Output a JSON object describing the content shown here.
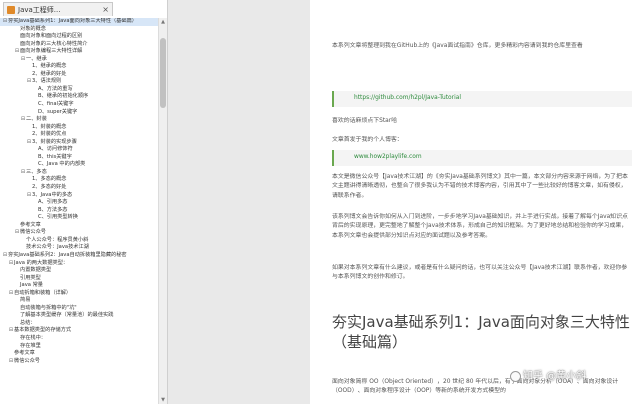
{
  "sidebar": {
    "tab_label": "Java工程师...",
    "tab_close": "×",
    "tree": [
      {
        "label": "夯实Java基础系列1：Java面向对象三大特性（基础篇）",
        "expander": "⊟"
      },
      {
        "label": "对象的概念",
        "expander": ""
      },
      {
        "label": "面向对象和面向过程的区别",
        "expander": ""
      },
      {
        "label": "面向对象的三大核心特性简介",
        "expander": ""
      },
      {
        "label": "面向对象编程三大特性详解",
        "expander": "⊟"
      },
      {
        "label": "一、继承",
        "expander": "⊟"
      },
      {
        "label": "1、继承的概念",
        "expander": ""
      },
      {
        "label": "2、继承的好处",
        "expander": ""
      },
      {
        "label": "3、语法规则",
        "expander": "⊟"
      },
      {
        "label": "A、方法的重写",
        "expander": ""
      },
      {
        "label": "B、继承的初始化顺序",
        "expander": ""
      },
      {
        "label": "C、final关键字",
        "expander": ""
      },
      {
        "label": "D、super关键字",
        "expander": ""
      },
      {
        "label": "二、封装",
        "expander": "⊟"
      },
      {
        "label": "1、封装的概念",
        "expander": ""
      },
      {
        "label": "2、封装的优点",
        "expander": ""
      },
      {
        "label": "3、封装的实现步骤",
        "expander": "⊟"
      },
      {
        "label": "A、访问修饰符",
        "expander": ""
      },
      {
        "label": "B、this关键字",
        "expander": ""
      },
      {
        "label": "C、Java 中的内部类",
        "expander": ""
      },
      {
        "label": "三、多态",
        "expander": "⊟"
      },
      {
        "label": "1、多态的概念",
        "expander": ""
      },
      {
        "label": "2、多态的好处",
        "expander": ""
      },
      {
        "label": "3、Java中的多态",
        "expander": "⊟"
      },
      {
        "label": "A、引用多态",
        "expander": ""
      },
      {
        "label": "B、方法多态",
        "expander": ""
      },
      {
        "label": "C、引用类型转换",
        "expander": ""
      },
      {
        "label": "参考文章",
        "expander": ""
      },
      {
        "label": "微信公众号",
        "expander": "⊟"
      },
      {
        "label": "个人公众号：程序员黄小斜",
        "expander": ""
      },
      {
        "label": "技术公众号：Java技术江湖",
        "expander": ""
      },
      {
        "label": "夯实Java基础系列2：Java自动拆装箱里隐藏的秘密",
        "expander": "⊟"
      },
      {
        "label": "Java 的两大数据类型：",
        "expander": "⊟"
      },
      {
        "label": "内置数据类型",
        "expander": ""
      },
      {
        "label": "引用类型",
        "expander": ""
      },
      {
        "label": "Java 常量",
        "expander": ""
      },
      {
        "label": "自动拆箱和装箱（详解）",
        "expander": "⊟"
      },
      {
        "label": "简易",
        "expander": ""
      },
      {
        "label": "自动装箱与拆箱中的\"坑\"",
        "expander": ""
      },
      {
        "label": "了解基本类型缓存（常量池）的最佳实践",
        "expander": ""
      },
      {
        "label": "总结：",
        "expander": ""
      },
      {
        "label": "基本数据类型的存储方式",
        "expander": "⊟"
      },
      {
        "label": "存在栈中：",
        "expander": ""
      },
      {
        "label": "存在堆里",
        "expander": ""
      },
      {
        "label": "参考文章",
        "expander": ""
      },
      {
        "label": "微信公众号",
        "expander": "⊟"
      }
    ],
    "scroll_up": "▲",
    "scroll_down": "▼"
  },
  "document": {
    "p1": "本系列文章将整理到我在GitHub上的《Java面试指南》仓库，更多精彩内容请到我的仓库里查看",
    "link1": "https://github.com/h2pl/Java-Tutorial",
    "p2": "喜欢的话麻烦点下Star哈",
    "p3": "文章首发于我的个人博客：",
    "link2": "www.how2playlife.com",
    "p4": "本文是微信公众号【Java技术江湖】的《夯实Java基础系列博文》其中一篇，本文部分内容来源于网络，为了把本文主题讲得清晰透彻，也整合了很多我认为不错的技术博客内容，引用其中了一些比较好的博客文章，如有侵权，请联系作者。",
    "p5": "该系列博文会告诉你如何从入门到进阶，一步步地学习Java基础知识，并上手进行实战，接着了解每个Java知识点背后的实现原理，更完整地了解整个Java技术体系，形成自己的知识框架。为了更好地总结和检验你的学习成果，本系列文章也会提供部分知识点对应的面试题以及参考答案。",
    "p6": "如果对本系列文章有什么建议，或者是有什么疑问的话，也可以关注公众号【Java技术江湖】联系作者，欢迎你参与本系列博文的创作和修订。",
    "title": "夯实Java基础系列1：Java面向对象三大特性（基础篇）",
    "p7": "面向对象简称 OO（Object Oriented），20 世纪 80 年代以后，有了面向对象分析（OOA）、面向对象设计（OOD）、面向对象程序设计（OOP）等新的系统开发方式模型的"
  },
  "watermark": {
    "text": "知乎 @黄小斜"
  }
}
